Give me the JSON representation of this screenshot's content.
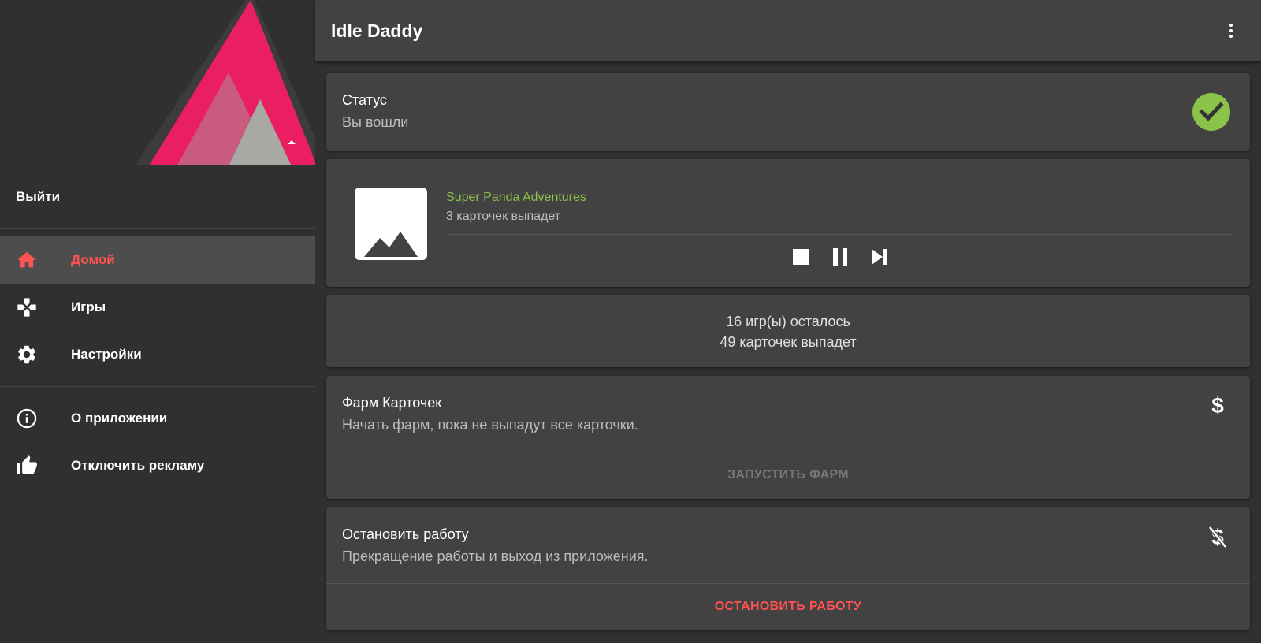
{
  "colors": {
    "accent": "#ff5252",
    "brand_pink": "#e91e63",
    "success": "#8bc34a",
    "surface": "#424242",
    "background": "#303030"
  },
  "drawer": {
    "account_label": "Выйти",
    "nav_primary": [
      {
        "label": "Домой",
        "icon": "home-icon",
        "active": true
      },
      {
        "label": "Игры",
        "icon": "gamepad-icon",
        "active": false
      },
      {
        "label": "Настройки",
        "icon": "settings-icon",
        "active": false
      }
    ],
    "nav_secondary": [
      {
        "label": "О приложении",
        "icon": "info-icon"
      },
      {
        "label": "Отключить рекламу",
        "icon": "thumb-up-icon"
      }
    ]
  },
  "toolbar": {
    "title": "Idle Daddy",
    "menu_icon": "more-vert-icon"
  },
  "status": {
    "title": "Статус",
    "value": "Вы вошли",
    "icon": "check-circle-icon"
  },
  "current_game": {
    "name": "Super Panda Adventures",
    "drops": "3 карточек выпадет",
    "thumbnail_icon": "image-placeholder-icon",
    "controls": [
      "stop-icon",
      "pause-icon",
      "skip-next-icon"
    ]
  },
  "summary": {
    "games_left": "16 игр(ы) осталось",
    "cards_left": "49 карточек выпадет"
  },
  "farm_card": {
    "title": "Фарм Карточек",
    "description": "Начать фарм, пока не выпадут все карточки.",
    "icon": "dollar-icon",
    "button": "ЗАПУСТИТЬ ФАРМ"
  },
  "stop_card": {
    "title": "Остановить работу",
    "description": "Прекращение работы и выход из приложения.",
    "icon": "dollar-off-icon",
    "button": "ОСТАНОВИТЬ РАБОТУ"
  }
}
